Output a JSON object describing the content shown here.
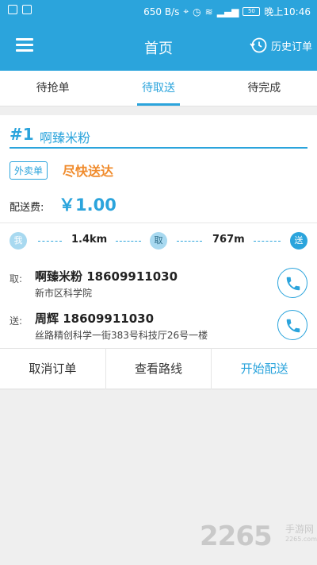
{
  "status_bar": {
    "network_speed": "650 B/s",
    "battery": "50",
    "time": "晚上10:46"
  },
  "header": {
    "title": "首页",
    "history_label": "历史订单"
  },
  "tabs": [
    {
      "label": "待抢单",
      "active": false
    },
    {
      "label": "待取送",
      "active": true
    },
    {
      "label": "待完成",
      "active": false
    }
  ],
  "order": {
    "number": "#1",
    "shop_name": "啊臻米粉",
    "type_tag": "外卖单",
    "urgency": "尽快送达",
    "fee_label": "配送费:",
    "fee_value": "￥1.00",
    "route": {
      "me_label": "我",
      "distance_to_pickup": "1.4km",
      "pickup_label": "取",
      "distance_to_delivery": "767m",
      "delivery_label": "送"
    },
    "pickup": {
      "label": "取:",
      "name_phone": "啊臻米粉 18609911030",
      "address": "新市区科学院"
    },
    "delivery": {
      "label": "送:",
      "name_phone": "周辉 18609911030",
      "address": "丝路精创科学一街383号科技厅26号一楼"
    },
    "actions": {
      "cancel": "取消订单",
      "route": "查看路线",
      "start": "开始配送"
    }
  },
  "watermark": {
    "brand": "2265",
    "text": "手游网",
    "url": "2265.com"
  },
  "colors": {
    "primary": "#2ba4dc",
    "urgent": "#f08b2c",
    "background": "#efefef"
  }
}
